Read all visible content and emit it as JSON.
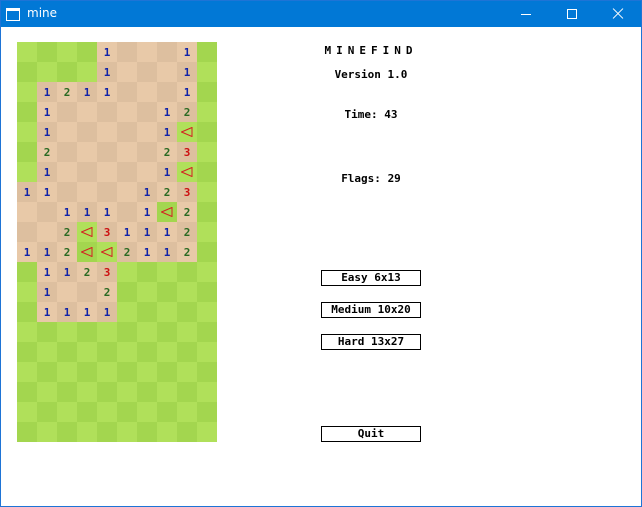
{
  "window": {
    "title": "mine"
  },
  "game": {
    "title": "MINEFIND",
    "version": "Version 1.0",
    "time_label": "Time:",
    "time": "43",
    "flags_label": "Flags:",
    "flags": "29"
  },
  "buttons": {
    "easy": "Easy 6x13",
    "medium": "Medium 10x20",
    "hard": "Hard 13x27",
    "quit": "Quit"
  },
  "colors": {
    "grass_light": "#b0e05a",
    "grass_dark": "#a3d64f",
    "dirt_light": "#e8c9a8",
    "dirt_dark": "#ddbf9f",
    "flag": "#d42020",
    "num1": "#1022a8",
    "num2": "#2a6a22",
    "num3": "#cc1111"
  },
  "board": {
    "legend": ". = unrevealed, _ = revealed empty, F = flag, digit = adjacent mine count",
    "rows": [
      "....1___1.",
      "....1___1.",
      ".1211___1.",
      ".1_____12.",
      ".1_____1F.",
      ".2_____23.",
      ".1_____1F.",
      "11____123.",
      "__111_1F2.",
      "__2F31112.",
      "112FF2112.",
      ".1123.....",
      ".1__2.....",
      ".1111.....",
      "..........",
      "..........",
      "..........",
      "..........",
      "..........",
      ".........."
    ]
  }
}
